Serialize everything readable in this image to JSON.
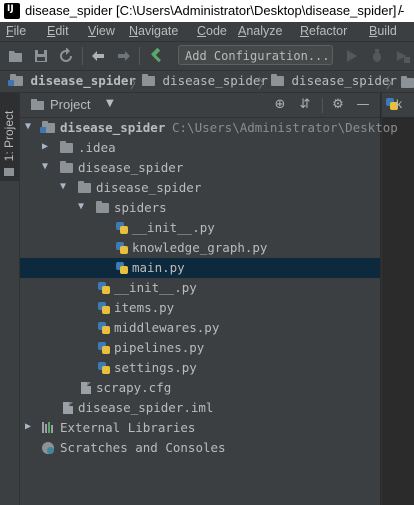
{
  "window": {
    "title": "disease_spider [C:\\Users\\Administrator\\Desktop\\disease_spider] - ",
    "partial_control": "/"
  },
  "menu": [
    "File",
    "Edit",
    "View",
    "Navigate",
    "Code",
    "Analyze",
    "Refactor",
    "Build"
  ],
  "toolbar": {
    "add_configuration": "Add Configuration...",
    "icons": [
      "folder-open-icon",
      "save-icon",
      "sync-icon",
      "back-icon",
      "forward-icon",
      "build-hammer-icon",
      "run-icon",
      "debug-icon",
      "run-with-coverage-icon"
    ]
  },
  "breadcrumb": {
    "items": [
      "disease_spider",
      "disease_spider",
      "disease_spider"
    ]
  },
  "side_tab": {
    "label": "1: Project"
  },
  "project_panel": {
    "title": "Project",
    "header_icons": [
      "locate-icon",
      "collapse-all-icon",
      "settings-icon",
      "hide-icon"
    ]
  },
  "editor_tab": {
    "label": "k"
  },
  "tree": [
    {
      "label": "disease_spider",
      "path": "C:\\Users\\Administrator\\Desktop",
      "expanded": true,
      "type": "module-folder",
      "bold": true
    },
    {
      "label": ".idea",
      "expanded": false,
      "type": "folder"
    },
    {
      "label": "disease_spider",
      "expanded": true,
      "type": "folder"
    },
    {
      "label": "disease_spider",
      "expanded": true,
      "type": "folder"
    },
    {
      "label": "spiders",
      "expanded": true,
      "type": "folder"
    },
    {
      "label": "__init__.py",
      "type": "python"
    },
    {
      "label": "knowledge_graph.py",
      "type": "python"
    },
    {
      "label": "main.py",
      "type": "python",
      "selected": true
    },
    {
      "label": "__init__.py",
      "type": "python"
    },
    {
      "label": "items.py",
      "type": "python"
    },
    {
      "label": "middlewares.py",
      "type": "python"
    },
    {
      "label": "pipelines.py",
      "type": "python"
    },
    {
      "label": "settings.py",
      "type": "python"
    },
    {
      "label": "scrapy.cfg",
      "type": "file"
    },
    {
      "label": "disease_spider.iml",
      "type": "file"
    },
    {
      "label": "External Libraries",
      "expanded": false,
      "type": "library"
    },
    {
      "label": "Scratches and Consoles",
      "type": "scratch"
    }
  ]
}
